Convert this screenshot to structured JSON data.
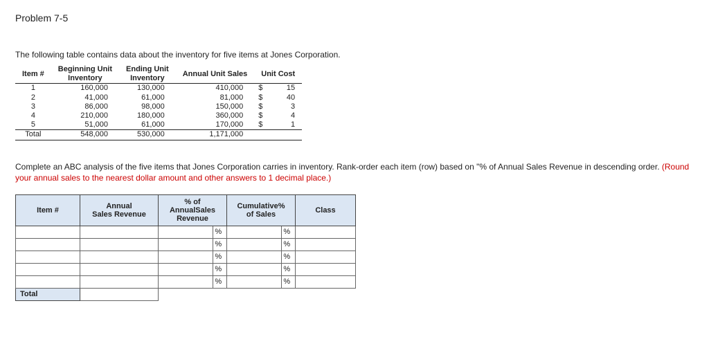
{
  "title": "Problem 7-5",
  "intro": "The following table contains data about the inventory for five items at Jones Corporation.",
  "data_table": {
    "headers": {
      "item": "Item #",
      "beg": "Beginning Unit\nInventory",
      "end": "Ending Unit\nInventory",
      "sales": "Annual Unit Sales",
      "cost": "Unit Cost"
    },
    "rows": [
      {
        "item": "1",
        "beg": "160,000",
        "end": "130,000",
        "sales": "410,000",
        "sym": "$",
        "cost": "15"
      },
      {
        "item": "2",
        "beg": "41,000",
        "end": "61,000",
        "sales": "81,000",
        "sym": "$",
        "cost": "40"
      },
      {
        "item": "3",
        "beg": "86,000",
        "end": "98,000",
        "sales": "150,000",
        "sym": "$",
        "cost": "3"
      },
      {
        "item": "4",
        "beg": "210,000",
        "end": "180,000",
        "sales": "360,000",
        "sym": "$",
        "cost": "4"
      },
      {
        "item": "5",
        "beg": "51,000",
        "end": "61,000",
        "sales": "170,000",
        "sym": "$",
        "cost": "1"
      }
    ],
    "total": {
      "label": "Total",
      "beg": "548,000",
      "end": "530,000",
      "sales": "1,171,000"
    }
  },
  "instruction_main": "Complete an ABC analysis of the five items that Jones Corporation carries in inventory. Rank-order each item (row) based on \"% of Annual Sales Revenue in descending order. ",
  "instruction_red": "(Round your annual sales to the nearest dollar amount and other answers to 1 decimal place.)",
  "answer_table": {
    "headers": {
      "item": "Item #",
      "rev": "Annual\nSales Revenue",
      "pct": "% of\nAnnualSales\nRevenue",
      "cum": "Cumulative%\nof Sales",
      "class": "Class"
    },
    "pct_label": "%",
    "total_label": "Total"
  },
  "chart_data": {
    "type": "table",
    "title": "Inventory data for five items at Jones Corporation",
    "columns": [
      "Item #",
      "Beginning Unit Inventory",
      "Ending Unit Inventory",
      "Annual Unit Sales",
      "Unit Cost ($)"
    ],
    "rows": [
      [
        1,
        160000,
        130000,
        410000,
        15
      ],
      [
        2,
        41000,
        61000,
        81000,
        40
      ],
      [
        3,
        86000,
        98000,
        150000,
        3
      ],
      [
        4,
        210000,
        180000,
        360000,
        4
      ],
      [
        5,
        51000,
        61000,
        170000,
        1
      ]
    ],
    "totals": {
      "Beginning Unit Inventory": 548000,
      "Ending Unit Inventory": 530000,
      "Annual Unit Sales": 1171000
    }
  }
}
